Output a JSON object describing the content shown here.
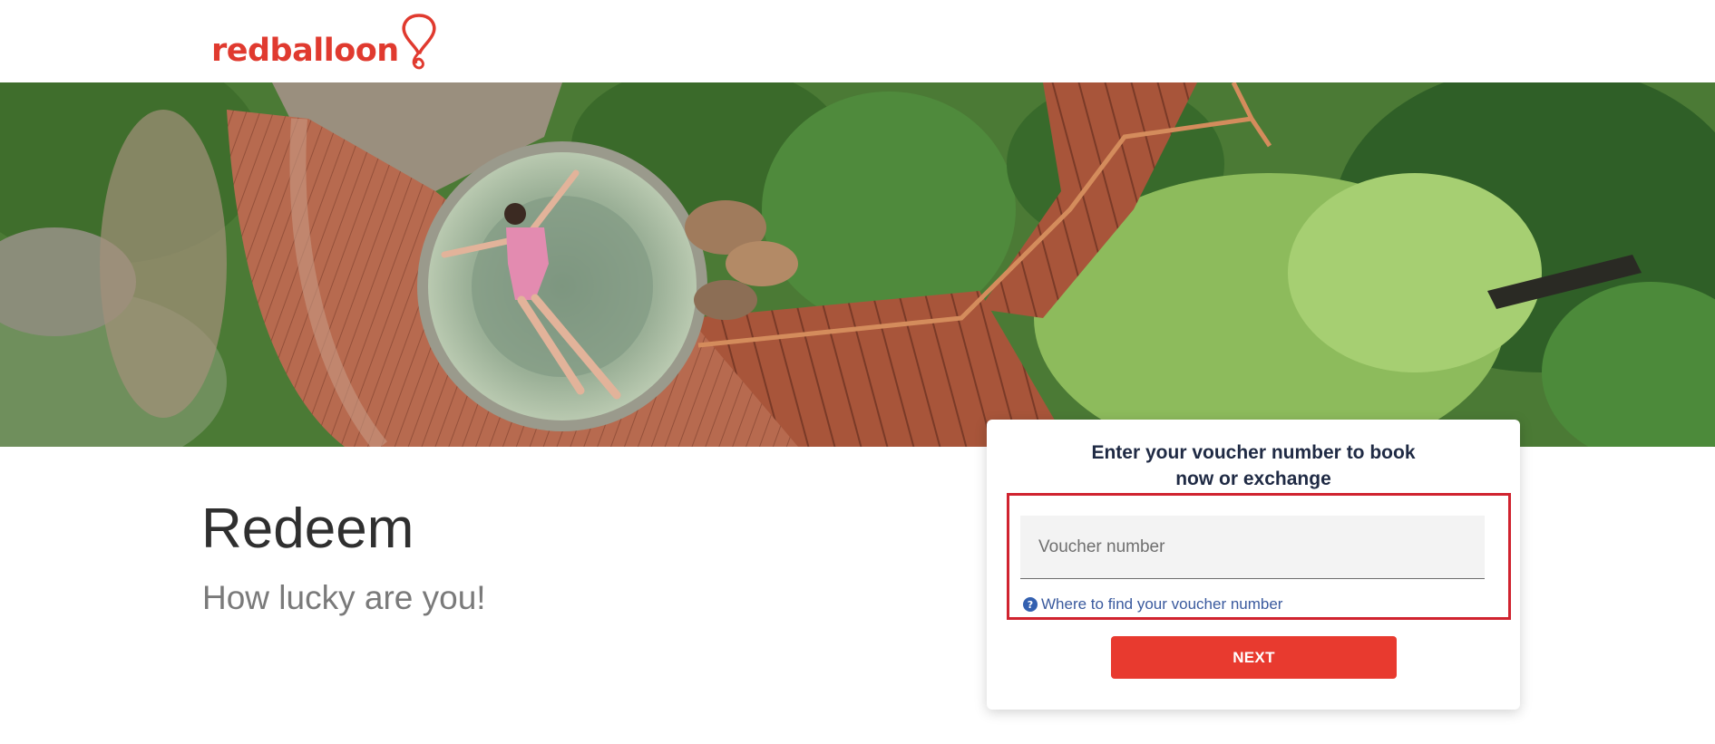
{
  "brand": {
    "name": "redballoon",
    "color": "#e03a2f"
  },
  "hero": {
    "image": "aerial-view-woman-floating-in-round-plunge-pool-on-wooden-deck-among-trees"
  },
  "intro": {
    "title": "Redeem",
    "subtitle": "How lucky are you!"
  },
  "voucher_card": {
    "heading_line1": "Enter your voucher number to book",
    "heading_line2": "now or exchange",
    "input": {
      "placeholder": "Voucher number",
      "value": ""
    },
    "help_icon": "question-circle-icon",
    "help_link": "Where to find your voucher number",
    "next_label": "NEXT",
    "highlight_color": "#d0232f",
    "button_color": "#e83a2f"
  }
}
